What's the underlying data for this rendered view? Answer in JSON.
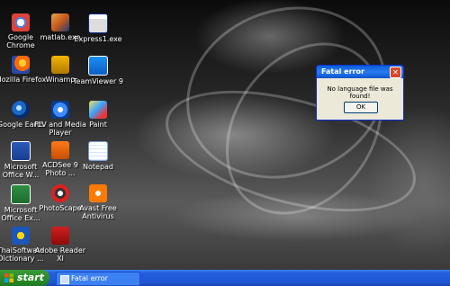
{
  "desktop": {
    "icons": [
      {
        "label": "Google Chrome",
        "icon": "chrome-icon"
      },
      {
        "label": "matlab.exe",
        "icon": "matlab-icon"
      },
      {
        "label": "Express1.exe",
        "icon": "app-window-icon"
      },
      {
        "label": "Mozilla Firefox",
        "icon": "firefox-icon"
      },
      {
        "label": "Winamp",
        "icon": "winamp-icon"
      },
      {
        "label": "TeamViewer 9",
        "icon": "teamviewer-icon"
      },
      {
        "label": "Google Earth",
        "icon": "google-earth-icon"
      },
      {
        "label": "FLV and Media Player",
        "icon": "flv-player-icon"
      },
      {
        "label": "Paint",
        "icon": "paint-icon"
      },
      {
        "label": "Microsoft Office W...",
        "icon": "word-icon"
      },
      {
        "label": "ACDSee 9 Photo ...",
        "icon": "acdsee-icon"
      },
      {
        "label": "Notepad",
        "icon": "notepad-icon"
      },
      {
        "label": "Microsoft Office Ex...",
        "icon": "excel-icon"
      },
      {
        "label": "PhotoScape",
        "icon": "photoscape-icon"
      },
      {
        "label": "Avast Free Antivirus",
        "icon": "avast-icon"
      },
      {
        "label": "ThaiSoftware Dictionary ...",
        "icon": "thaisoftware-icon"
      },
      {
        "label": "Adobe Reader XI",
        "icon": "adobe-reader-icon"
      }
    ]
  },
  "dialog": {
    "title": "Fatal error",
    "message": "No language file was found!",
    "ok_label": "OK",
    "close_glyph": "✕"
  },
  "taskbar": {
    "start_label": "start",
    "tasks": [
      {
        "label": "Fatal error"
      }
    ]
  }
}
